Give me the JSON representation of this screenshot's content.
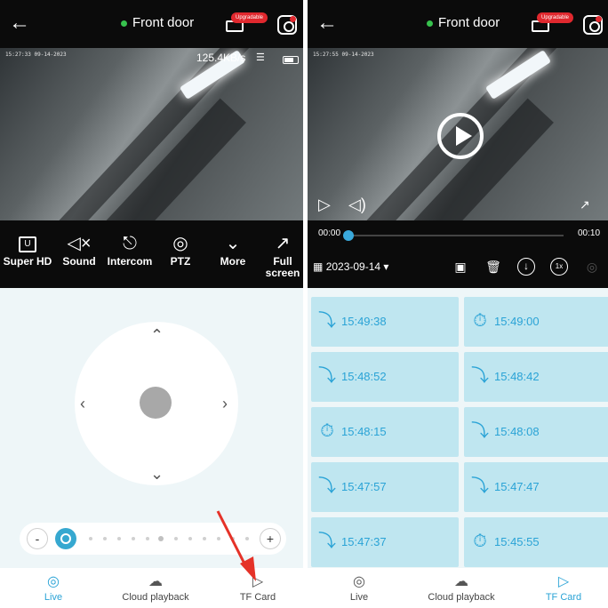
{
  "left": {
    "header": {
      "title": "Front door",
      "badge": "Upgradable"
    },
    "video": {
      "timestamp": "15:27:33 09-14-2023",
      "bitrate": "125.4KB/s"
    },
    "controls": [
      {
        "label": "Super HD",
        "icon": "hd-icon"
      },
      {
        "label": "Sound",
        "icon": "speaker-muted-icon"
      },
      {
        "label": "Intercom",
        "icon": "microphone-icon"
      },
      {
        "label": "PTZ",
        "icon": "ptz-camera-icon"
      },
      {
        "label": "More",
        "icon": "chevron-down-icon"
      },
      {
        "label": "Full screen",
        "icon": "expand-icon"
      }
    ],
    "zoom": {
      "minus": "-",
      "plus": "+"
    },
    "tabs": [
      {
        "label": "Live",
        "icon": "live-eye-icon",
        "active": true
      },
      {
        "label": "Cloud playback",
        "icon": "cloud-playback-icon",
        "active": false
      },
      {
        "label": "TF Card",
        "icon": "tf-card-icon",
        "active": false
      }
    ]
  },
  "right": {
    "header": {
      "title": "Front door",
      "badge": "Upgradable"
    },
    "video": {
      "timestamp": "15:27:55 09-14-2023"
    },
    "playback": {
      "current_time": "00:00",
      "total_time": "00:10",
      "date": "2023-09-14",
      "speed": "1x"
    },
    "events": [
      {
        "time": "15:49:38",
        "type": "motion"
      },
      {
        "time": "15:49:00",
        "type": "timer"
      },
      {
        "time": "15:48:52",
        "type": "motion"
      },
      {
        "time": "15:48:42",
        "type": "motion"
      },
      {
        "time": "15:48:15",
        "type": "timer"
      },
      {
        "time": "15:48:08",
        "type": "motion"
      },
      {
        "time": "15:47:57",
        "type": "motion"
      },
      {
        "time": "15:47:47",
        "type": "motion"
      },
      {
        "time": "15:47:37",
        "type": "motion"
      },
      {
        "time": "15:45:55",
        "type": "timer"
      }
    ],
    "tabs": [
      {
        "label": "Live",
        "icon": "live-eye-icon",
        "active": false
      },
      {
        "label": "Cloud playback",
        "icon": "cloud-playback-icon",
        "active": false
      },
      {
        "label": "TF Card",
        "icon": "tf-card-icon",
        "active": true
      }
    ]
  },
  "colors": {
    "accent": "#2aa3d6",
    "event_bg": "#bfe6f0",
    "online": "#37c24d",
    "badge": "#e0282e",
    "bar_bg": "#0b0b0b"
  }
}
